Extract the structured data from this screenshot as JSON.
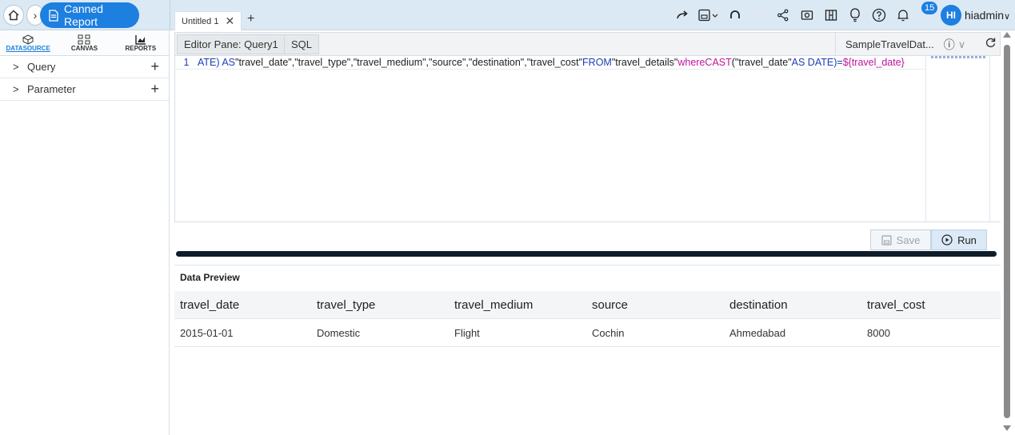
{
  "breadcrumb": {
    "current": "Canned Report"
  },
  "tabs": [
    {
      "label": "Untitled 1"
    }
  ],
  "header": {
    "notification_count": "15",
    "avatar_initials": "HI",
    "username": "hiadmin"
  },
  "left_panel": {
    "tabs": [
      {
        "label": "DATASOURCE",
        "active": true
      },
      {
        "label": "CANVAS",
        "active": false
      },
      {
        "label": "REPORTS",
        "active": false
      }
    ],
    "sections": [
      {
        "label": "Query"
      },
      {
        "label": "Parameter"
      }
    ]
  },
  "editor": {
    "pane_label": "Editor Pane: Query1",
    "language": "SQL",
    "datasource": "SampleTravelDat...",
    "line_number": "1",
    "code": {
      "seg1": "ATE) AS ",
      "seg2": "\"travel_date\",\"travel_type\",\"travel_medium\",\"source\",\"destination\",\"travel_cost\" ",
      "seg3": "FROM ",
      "seg4": "\"travel_details\" ",
      "seg5": "where ",
      "seg6": "CAST",
      "seg7": "(\"travel_date\" ",
      "seg8": "AS DATE)=",
      "seg9": "${travel_date}"
    },
    "save_label": "Save",
    "run_label": "Run"
  },
  "preview": {
    "title": "Data Preview",
    "columns": [
      "travel_date",
      "travel_type",
      "travel_medium",
      "source",
      "destination",
      "travel_cost"
    ],
    "rows": [
      [
        "2015-01-01",
        "Domestic",
        "Flight",
        "Cochin",
        "Ahmedabad",
        "8000"
      ]
    ]
  },
  "colors": {
    "accent": "#1d7fe0",
    "topbar": "#dbe9f4",
    "keyword": "#1a3fb5",
    "function": "#c0139a"
  },
  "icons": [
    "home-icon",
    "report-icon",
    "close-icon",
    "add-icon",
    "redo-icon",
    "save-as-icon",
    "undo-icon",
    "loading-icon",
    "share-icon",
    "camera-icon",
    "layout-icon",
    "bulb-icon",
    "help-icon",
    "bell-icon",
    "cube-icon",
    "canvas-icon",
    "chart-icon",
    "info-icon",
    "refresh-icon",
    "run-icon"
  ]
}
